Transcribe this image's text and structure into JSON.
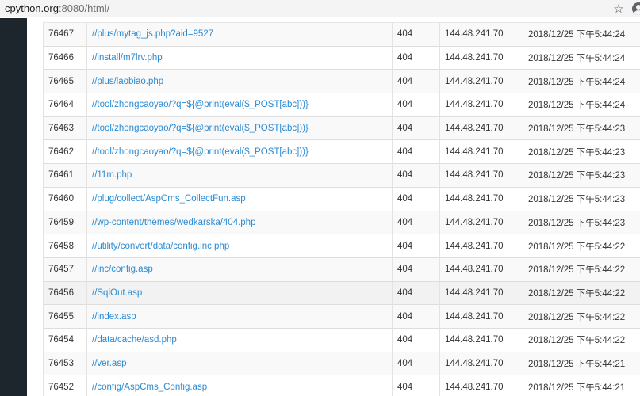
{
  "browser": {
    "url_host": "cpython.org",
    "url_rest": ":8080/html/",
    "bookmark_icon": "star-icon",
    "profile_icon": "account-circle-icon"
  },
  "log": {
    "rows": [
      {
        "id": "76467",
        "path": "//plus/mytag_js.php?aid=9527",
        "status": "404",
        "ip": "144.48.241.70",
        "time": "2018/12/25 下午5:44:24"
      },
      {
        "id": "76466",
        "path": "//install/m7lrv.php",
        "status": "404",
        "ip": "144.48.241.70",
        "time": "2018/12/25 下午5:44:24"
      },
      {
        "id": "76465",
        "path": "//plus/laobiao.php",
        "status": "404",
        "ip": "144.48.241.70",
        "time": "2018/12/25 下午5:44:24"
      },
      {
        "id": "76464",
        "path": "//tool/zhongcaoyao/?q=${@print(eval($_POST[abc]))}",
        "status": "404",
        "ip": "144.48.241.70",
        "time": "2018/12/25 下午5:44:24"
      },
      {
        "id": "76463",
        "path": "//tool/zhongcaoyao/?q=${@print(eval($_POST[abc]))}",
        "status": "404",
        "ip": "144.48.241.70",
        "time": "2018/12/25 下午5:44:23"
      },
      {
        "id": "76462",
        "path": "//tool/zhongcaoyao/?q=${@print(eval($_POST[abc]))}",
        "status": "404",
        "ip": "144.48.241.70",
        "time": "2018/12/25 下午5:44:23"
      },
      {
        "id": "76461",
        "path": "//11m.php",
        "status": "404",
        "ip": "144.48.241.70",
        "time": "2018/12/25 下午5:44:23"
      },
      {
        "id": "76460",
        "path": "//plug/collect/AspCms_CollectFun.asp",
        "status": "404",
        "ip": "144.48.241.70",
        "time": "2018/12/25 下午5:44:23"
      },
      {
        "id": "76459",
        "path": "//wp-content/themes/wedkarska/404.php",
        "status": "404",
        "ip": "144.48.241.70",
        "time": "2018/12/25 下午5:44:23"
      },
      {
        "id": "76458",
        "path": "//utility/convert/data/config.inc.php",
        "status": "404",
        "ip": "144.48.241.70",
        "time": "2018/12/25 下午5:44:22"
      },
      {
        "id": "76457",
        "path": "//inc/config.asp",
        "status": "404",
        "ip": "144.48.241.70",
        "time": "2018/12/25 下午5:44:22"
      },
      {
        "id": "76456",
        "path": "//SqlOut.asp",
        "status": "404",
        "ip": "144.48.241.70",
        "time": "2018/12/25 下午5:44:22"
      },
      {
        "id": "76455",
        "path": "//index.asp",
        "status": "404",
        "ip": "144.48.241.70",
        "time": "2018/12/25 下午5:44:22"
      },
      {
        "id": "76454",
        "path": "//data/cache/asd.php",
        "status": "404",
        "ip": "144.48.241.70",
        "time": "2018/12/25 下午5:44:22"
      },
      {
        "id": "76453",
        "path": "//ver.asp",
        "status": "404",
        "ip": "144.48.241.70",
        "time": "2018/12/25 下午5:44:21"
      },
      {
        "id": "76452",
        "path": "//config/AspCms_Config.asp",
        "status": "404",
        "ip": "144.48.241.70",
        "time": "2018/12/25 下午5:44:21"
      }
    ]
  },
  "colors": {
    "sidebar": "#1d262d",
    "link": "#2a8bd4",
    "row_stripe": "#f9f9f9",
    "row_hover": "#f2f2f2"
  }
}
